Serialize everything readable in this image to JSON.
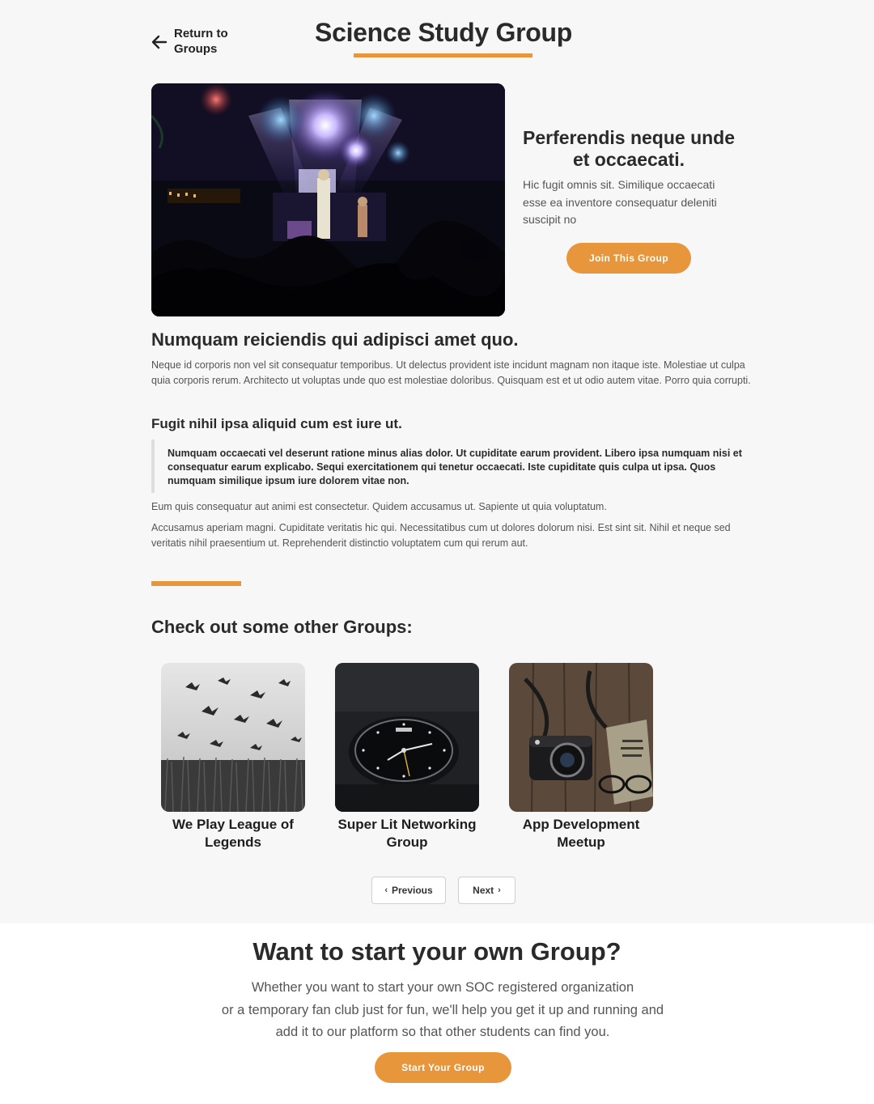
{
  "header": {
    "back_label": "Return to Groups",
    "title": "Science Study Group"
  },
  "hero": {
    "image_alt": "concert stage with lights",
    "heading": "Perferendis neque unde et occaecati.",
    "description": "Hic fugit omnis sit. Similique occaecati esse ea inventore consequatur deleniti suscipit no",
    "join_label": "Join This Group"
  },
  "article": {
    "heading": "Numquam reiciendis qui adipisci amet quo.",
    "paragraph1": "Neque id corporis non vel sit consequatur temporibus. Ut delectus provident iste incidunt magnam non itaque iste. Molestiae ut culpa quia corporis rerum. Architecto ut voluptas unde quo est molestiae doloribus. Quisquam est et ut odio autem vitae. Porro quia corrupti.",
    "subheading": "Fugit nihil ipsa aliquid cum est iure ut.",
    "quote": "Numquam occaecati vel deserunt ratione minus alias dolor. Ut cupiditate earum provident. Libero ipsa numquam nisi et consequatur earum explicabo. Sequi exercitationem qui tenetur occaecati. Iste cupiditate quis culpa ut ipsa. Quos numquam similique ipsum iure dolorem vitae non.",
    "paragraph2": "Eum quis consequatur aut animi est consectetur. Quidem accusamus ut. Sapiente ut quia voluptatum.",
    "paragraph3": "Accusamus aperiam magni. Cupiditate veritatis hic qui. Necessitatibus cum ut dolores dolorum nisi. Est sint sit. Nihil et neque sed veritatis nihil praesentium ut. Reprehenderit distinctio voluptatem cum qui rerum aut."
  },
  "others": {
    "heading": "Check out some other Groups:",
    "cards": [
      {
        "title": "We Play League of Legends",
        "image": "birds-over-field"
      },
      {
        "title": "Super Lit Networking Group",
        "image": "wristwatch"
      },
      {
        "title": "App Development Meetup",
        "image": "camera-and-glasses"
      }
    ]
  },
  "pagination": {
    "previous_label": "Previous",
    "next_label": "Next"
  },
  "cta": {
    "heading": "Want to start your own Group?",
    "line1": "Whether you want to start your own SOC registered organization",
    "line2": "or a temporary fan club just for fun, we'll help you get it up and running and",
    "line3": "add it to our platform so that other students can find you.",
    "button_label": "Start Your Group"
  },
  "colors": {
    "accent": "#e8963c",
    "background": "#f7f7f7",
    "heading": "#2a2a2a"
  }
}
